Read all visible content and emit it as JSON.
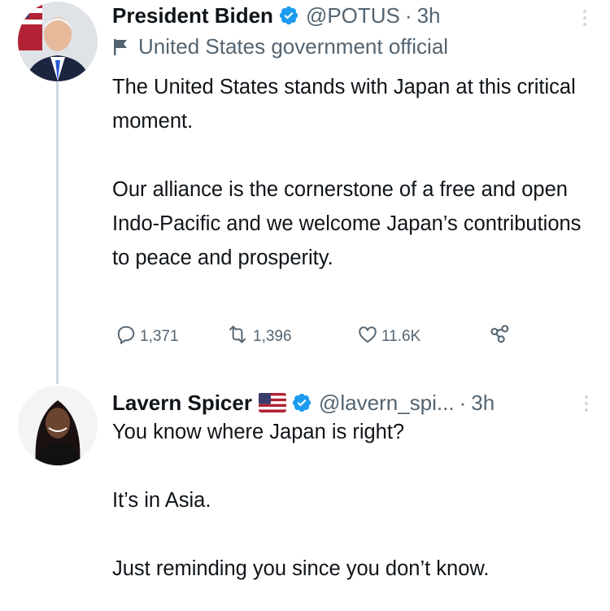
{
  "tweet1": {
    "name": "President Biden",
    "handle": "@POTUS",
    "separator": "·",
    "time": "3h",
    "label": "United States government official",
    "paragraphs": [
      "The United States stands with Japan at this critical moment.",
      "Our alliance is the cornerstone of a free and open Indo-Pacific and we welcome Japan’s contributions to peace and prosperity."
    ],
    "replies": "1,371",
    "retweets": "1,396",
    "likes": "11.6K"
  },
  "tweet2": {
    "name": "Lavern Spicer",
    "handle": "@lavern_spi...",
    "separator": "·",
    "time": "3h",
    "paragraphs": [
      "You know where Japan is right?",
      "It’s in Asia.",
      "Just reminding you since you don’t know."
    ]
  },
  "colors": {
    "verified": "#1d9bf0",
    "secondary": "#536471",
    "thread_line": "#cfd9de"
  },
  "icons": [
    "verified-badge-icon",
    "government-flag-icon",
    "reply-icon",
    "retweet-icon",
    "like-icon",
    "share-icon",
    "more-icon",
    "us-flag-emoji"
  ]
}
